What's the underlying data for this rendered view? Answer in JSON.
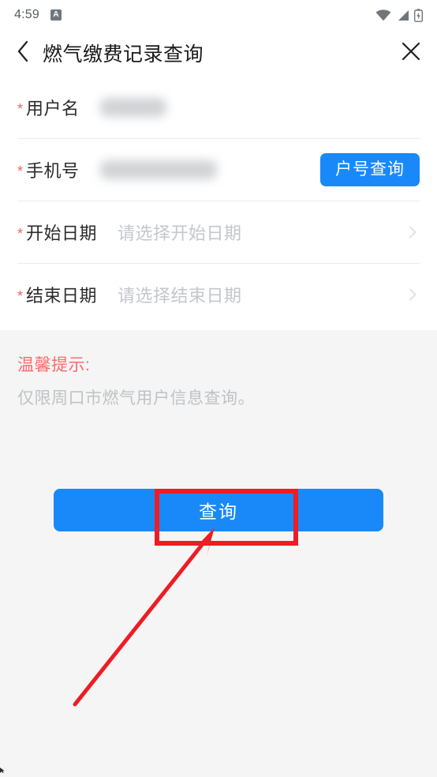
{
  "statusbar": {
    "time": "4:59",
    "app_badge": "A",
    "icons": [
      "wifi-icon",
      "signal-icon",
      "battery-charging-icon"
    ]
  },
  "navbar": {
    "back_icon": "chevron-left-icon",
    "title": "燃气缴费记录查询",
    "close_icon": "close-icon"
  },
  "form": {
    "required_marker": "*",
    "rows": [
      {
        "label": "用户名",
        "required": true,
        "value": "",
        "value_redacted": true,
        "placeholder": "",
        "action": null,
        "chevron": false
      },
      {
        "label": "手机号",
        "required": true,
        "value": "",
        "value_redacted": true,
        "placeholder": "",
        "action": "户号查询",
        "chevron": false
      },
      {
        "label": "开始日期",
        "required": true,
        "value": "",
        "value_redacted": false,
        "placeholder": "请选择开始日期",
        "action": null,
        "chevron": true
      },
      {
        "label": "结束日期",
        "required": true,
        "value": "",
        "value_redacted": false,
        "placeholder": "请选择结束日期",
        "action": null,
        "chevron": true
      }
    ]
  },
  "tips": {
    "title": "温馨提示:",
    "body": "仅限周口市燃气用户信息查询。"
  },
  "submit": {
    "label": "查询"
  },
  "annotation": {
    "highlight_icon": "red-rectangle-highlight",
    "pointer_icon": "red-arrow-pointer",
    "color": "#ee1c24",
    "target": "查询"
  },
  "colors": {
    "accent_blue": "#1989fa",
    "required_red": "#f76260",
    "tip_red": "#fa6a6a",
    "page_bg": "#f5f5f5",
    "card_bg": "#ffffff",
    "placeholder_gray": "#c4c7cc",
    "annotation_red": "#ee1c24"
  }
}
